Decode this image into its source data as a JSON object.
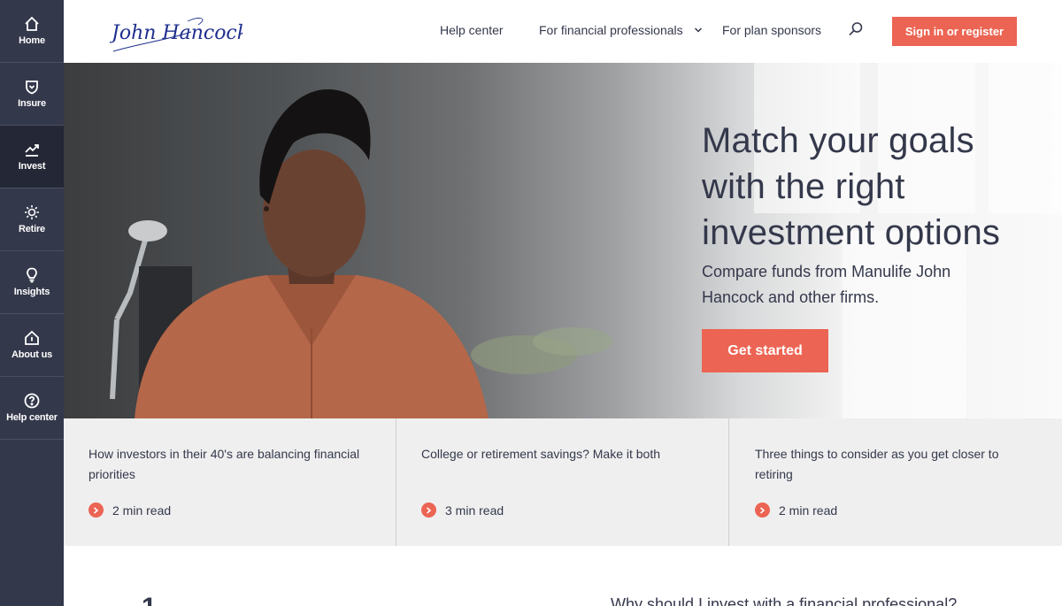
{
  "sidebar": {
    "items": [
      {
        "label": "Home",
        "icon": "home-icon"
      },
      {
        "label": "Insure",
        "icon": "shield-icon"
      },
      {
        "label": "Invest",
        "icon": "trend-up-icon"
      },
      {
        "label": "Retire",
        "icon": "sun-icon"
      },
      {
        "label": "Insights",
        "icon": "lightbulb-icon"
      },
      {
        "label": "About us",
        "icon": "house-info-icon"
      },
      {
        "label": "Help center",
        "icon": "question-circle-icon"
      }
    ],
    "active": "Invest"
  },
  "header": {
    "logo_text": "John Hancock",
    "nav": {
      "help_center": "Help center",
      "financial_professionals": "For financial professionals",
      "plan_sponsors": "For plan sponsors"
    },
    "signin_label": "Sign in or register"
  },
  "hero": {
    "title": "Match your goals with the right investment options",
    "subtitle": "Compare funds from Manulife John Hancock and other firms.",
    "cta_label": "Get started"
  },
  "articles": [
    {
      "title": "How investors in their 40's are balancing financial priorities",
      "read_time": "2 min read"
    },
    {
      "title": "College or retirement savings? Make it both",
      "read_time": "3 min read"
    },
    {
      "title": "Three things to consider as you get closer to retiring",
      "read_time": "2 min read"
    }
  ],
  "bottom": {
    "number": "1",
    "question": "Why should I invest with a financial professional?"
  },
  "colors": {
    "accent": "#ec6453",
    "sidebar": "#34384b",
    "sidebar_active": "#242736",
    "card_bg": "#efefef",
    "logo": "#1f2f8f"
  }
}
